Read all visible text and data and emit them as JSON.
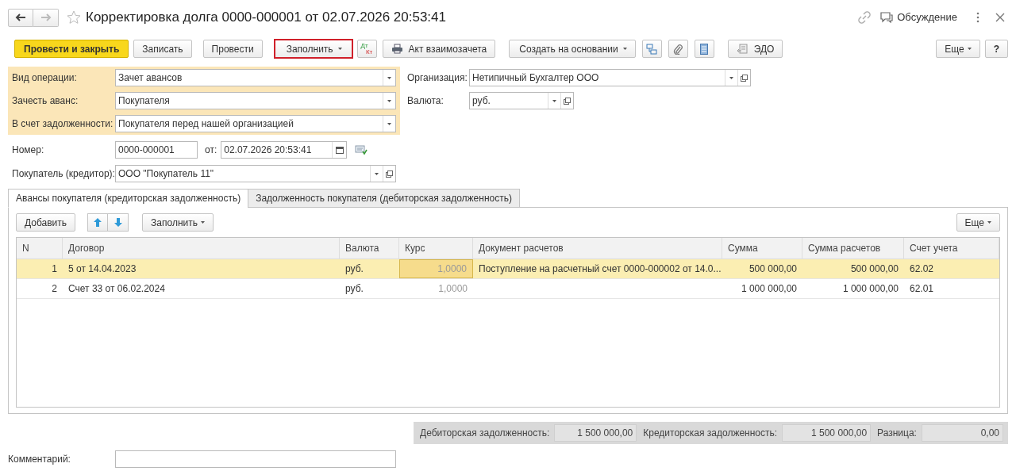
{
  "window": {
    "title": "Корректировка долга 0000-000001 от 02.07.2026 20:53:41",
    "back_enabled": true,
    "forward_enabled": false,
    "favorite": false,
    "discussion": "Обсуждение"
  },
  "toolbar": {
    "items": [
      {
        "kind": "primary",
        "label": "Провести и закрыть"
      },
      {
        "kind": "button",
        "label": "Записать"
      },
      {
        "kind": "button",
        "label": "Провести"
      },
      {
        "kind": "menu",
        "label": "Заполнить",
        "highlighted": true
      },
      {
        "kind": "dtkt",
        "dt": "Дт",
        "kt": "Кт"
      },
      {
        "kind": "print",
        "label": "Акт взаимозачета"
      },
      {
        "kind": "menu",
        "label": "Создать на основании",
        "highlighted": false
      },
      {
        "kind": "structure"
      },
      {
        "kind": "clip"
      },
      {
        "kind": "list"
      },
      {
        "kind": "edo",
        "label": "ЭДО"
      }
    ],
    "more": "Еще",
    "help": "?"
  },
  "operation_fields": [
    {
      "label": "Вид операции:",
      "value": "Зачет авансов"
    },
    {
      "label": "Зачесть аванс:",
      "value": "Покупателя"
    },
    {
      "label": "В счет задолженности:",
      "value": "Покупателя перед нашей организацией"
    }
  ],
  "organization": {
    "label": "Организация:",
    "value": "Нетипичный Бухгалтер ООО"
  },
  "currency": {
    "label": "Валюта:",
    "value": "руб."
  },
  "number": {
    "label": "Номер:",
    "value": "0000-000001",
    "date_label": "от:",
    "date": "02.07.2026 20:53:41"
  },
  "buyer": {
    "label": "Покупатель (кредитор):",
    "value": "ООО \"Покупатель 11\""
  },
  "tabs": [
    {
      "label": "Авансы покупателя (кредиторская задолженность)",
      "selected": true
    },
    {
      "label": "Задолженность покупателя (дебиторская задолженность)",
      "selected": false
    }
  ],
  "table_toolbar": {
    "add": "Добавить",
    "fill": "Заполнить",
    "more": "Еще"
  },
  "table": {
    "columns": [
      "N",
      "Договор",
      "Валюта",
      "Курс",
      "Документ расчетов",
      "Сумма",
      "Сумма расчетов",
      "Счет учета"
    ],
    "rows": [
      {
        "selected": true,
        "rate_focused": true,
        "n": "1",
        "contract": "5 от 14.04.2023",
        "currency": "руб.",
        "rate": "1,0000",
        "document": "Поступление на расчетный счет 0000-000002 от 14.0...",
        "sum": "500 000,00",
        "sum_settle": "500 000,00",
        "account": "62.02"
      },
      {
        "selected": false,
        "rate_focused": false,
        "n": "2",
        "contract": "Счет 33 от 06.02.2024",
        "currency": "руб.",
        "rate": "1,0000",
        "sum": "1 000 000,00",
        "sum_settle": "1 000 000,00",
        "account": "62.01"
      }
    ]
  },
  "totals": [
    {
      "label": "Дебиторская задолженность:",
      "value": "1 500 000,00"
    },
    {
      "label": "Кредиторская задолженность:",
      "value": "1 500 000,00"
    },
    {
      "label": "Разница:",
      "value": "0,00"
    }
  ],
  "comment": {
    "label": "Комментарий:"
  }
}
